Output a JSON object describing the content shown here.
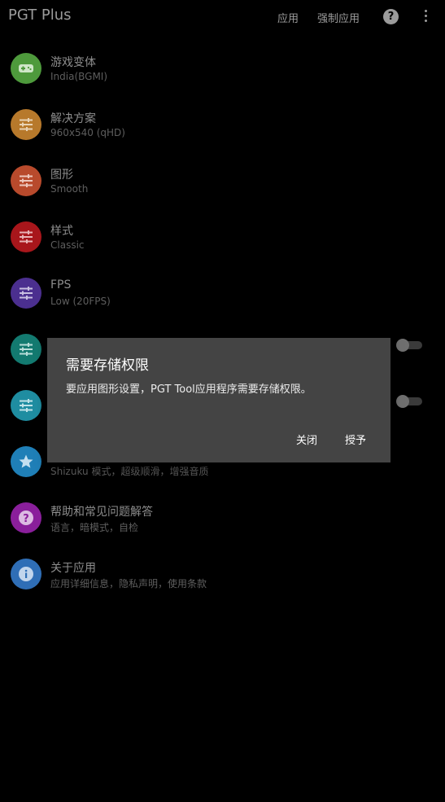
{
  "appbar": {
    "title": "PGT Plus",
    "apply_label": "应用",
    "force_apply_label": "强制应用",
    "help_icon": "help-circle-icon",
    "more_icon": "more-vert-icon"
  },
  "items": [
    {
      "title": "游戏变体",
      "subtitle": "India(BGMI)",
      "icon": "gamepad-icon",
      "color": "#4e9a3c"
    },
    {
      "title": "解决方案",
      "subtitle": "960x540 (qHD)",
      "icon": "tune-icon",
      "color": "#b7792b"
    },
    {
      "title": "图形",
      "subtitle": "Smooth",
      "icon": "tune-icon",
      "color": "#b84a2c"
    },
    {
      "title": "样式",
      "subtitle": "Classic",
      "icon": "tune-icon",
      "color": "#a8161b"
    },
    {
      "title": "FPS",
      "subtitle": "Low (20FPS)",
      "icon": "tune-icon",
      "color": "#4b2f8f"
    },
    {
      "title": "",
      "subtitle": "",
      "icon": "tune-icon",
      "color": "#137a70"
    },
    {
      "title": "",
      "subtitle": "",
      "icon": "tune-icon",
      "color": "#1f8da1"
    },
    {
      "title": "",
      "subtitle": "Shizuku 模式，超级顺滑，增强音质",
      "icon": "star-icon",
      "color": "#1f7fb7"
    },
    {
      "title": "帮助和常见问题解答",
      "subtitle": "语言，暗模式，自检",
      "icon": "help-icon",
      "color": "#8a1f9b"
    },
    {
      "title": "关于应用",
      "subtitle": "应用详细信息，隐私声明，使用条款",
      "icon": "info-icon",
      "color": "#2f6eb6"
    }
  ],
  "dialog": {
    "title": "需要存储权限",
    "message": "要应用图形设置，PGT Tool应用程序需要存储权限。",
    "close_label": "关闭",
    "grant_label": "授予"
  }
}
